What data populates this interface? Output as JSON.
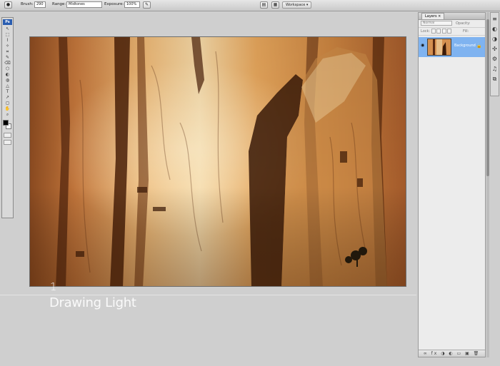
{
  "options_bar": {
    "brush_label": "Brush:",
    "brush_size": "290",
    "range_label": "Range:",
    "range_value": "Midtones",
    "exposure_label": "Exposure:",
    "exposure_value": "100%",
    "workspace_label": "Workspace ▾"
  },
  "toolbox": {
    "logo": "Ps",
    "tools": [
      "↖",
      "⬚",
      "⌇",
      "✧",
      "⌗",
      "✎",
      "⌫",
      "⬡",
      "◐",
      "◍",
      "△",
      "T",
      "↗",
      "◻",
      "✋",
      "⌕"
    ]
  },
  "lesson": {
    "number": "1",
    "title": "Drawing Light"
  },
  "layers_panel": {
    "tab": "Layers ×",
    "blend_mode": "Normal",
    "opacity_label": "Opacity:",
    "lock_label": "Lock:",
    "fill_label": "Fill:",
    "layer_name": "Background",
    "footer_icons": "∞ fx ◑ ◐ ▭ ▣ 🗑"
  },
  "dock": {
    "icons": [
      "≡",
      "◐",
      "◑",
      "✣",
      "⚙",
      "♫",
      "⧉"
    ]
  },
  "colors": {
    "selection": "#7fb3f0",
    "canvas_bg": "#cfcfcf",
    "rock_light": "#f0c98a",
    "rock_mid": "#d2883c",
    "rock_dark": "#6a3414"
  }
}
